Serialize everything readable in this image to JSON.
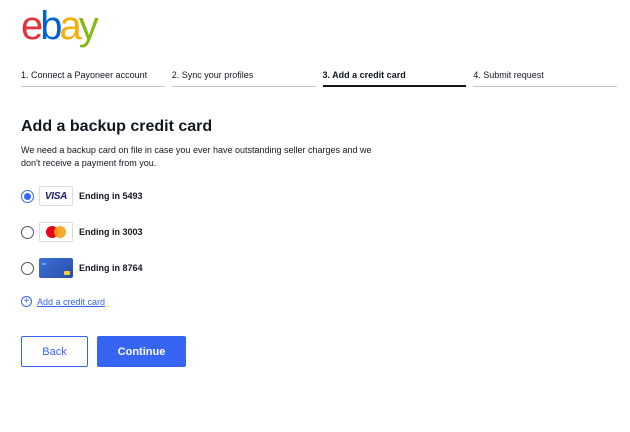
{
  "brand": {
    "letters": [
      "e",
      "b",
      "a",
      "y"
    ],
    "colors": [
      "#e53238",
      "#0064d2",
      "#f5af02",
      "#86b817"
    ]
  },
  "steps": [
    {
      "label": "1. Connect a Payoneer account",
      "active": false
    },
    {
      "label": "2. Sync your profiles",
      "active": false
    },
    {
      "label": "3. Add a credit card",
      "active": true
    },
    {
      "label": "4. Submit request",
      "active": false
    }
  ],
  "page": {
    "title": "Add a backup credit card",
    "description": "We need a backup card on file in case you ever have outstanding seller charges and we don't receive a payment from you."
  },
  "cards": [
    {
      "brand_icon": "visa-logo-icon",
      "brand_text": "VISA",
      "label": "Ending in 5493",
      "selected": true
    },
    {
      "brand_icon": "mastercard-logo-icon",
      "label": "Ending in 3003",
      "selected": false
    },
    {
      "brand_icon": "ebay-card-icon",
      "label": "Ending in 8764",
      "selected": false
    }
  ],
  "add_card": {
    "icon": "plus-circle-icon",
    "label": "Add a credit card"
  },
  "actions": {
    "back_label": "Back",
    "continue_label": "Continue"
  },
  "theme": {
    "accent": "#3665f3"
  }
}
